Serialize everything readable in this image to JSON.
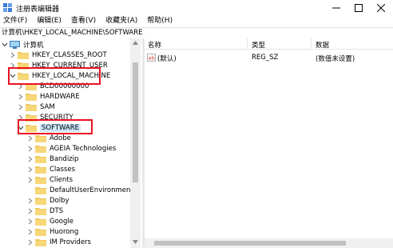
{
  "window": {
    "title": "注册表编辑器",
    "icon": "registry-editor-icon"
  },
  "menu": [
    "文件(F)",
    "编辑(E)",
    "查看(V)",
    "收藏夹(A)",
    "帮助(H)"
  ],
  "address": "计算机\\HKEY_LOCAL_MACHINE\\SOFTWARE",
  "tree": {
    "root": "计算机",
    "hives": {
      "classes_root": "HKEY_CLASSES_ROOT",
      "current_user": "HKEY_CURRENT_USER",
      "local_machine": "HKEY_LOCAL_MACHINE"
    },
    "hklm_children": [
      "BCD00000000",
      "HARDWARE",
      "SAM",
      "SECURITY",
      "SOFTWARE"
    ],
    "software_children": [
      "Adobe",
      "AGEIA Technologies",
      "Bandizip",
      "Classes",
      "Clients",
      "DefaultUserEnvironment",
      "Dolby",
      "DTS",
      "Google",
      "Huorong",
      "IM Providers"
    ]
  },
  "list": {
    "columns": [
      "名称",
      "类型",
      "数据"
    ],
    "rows": [
      {
        "name": "(默认)",
        "type": "REG_SZ",
        "data": "(数值未设置)"
      }
    ]
  },
  "colors": {
    "highlight_box": "#e81123",
    "folder": "#f0c75e",
    "selection": "#cce8ff"
  }
}
